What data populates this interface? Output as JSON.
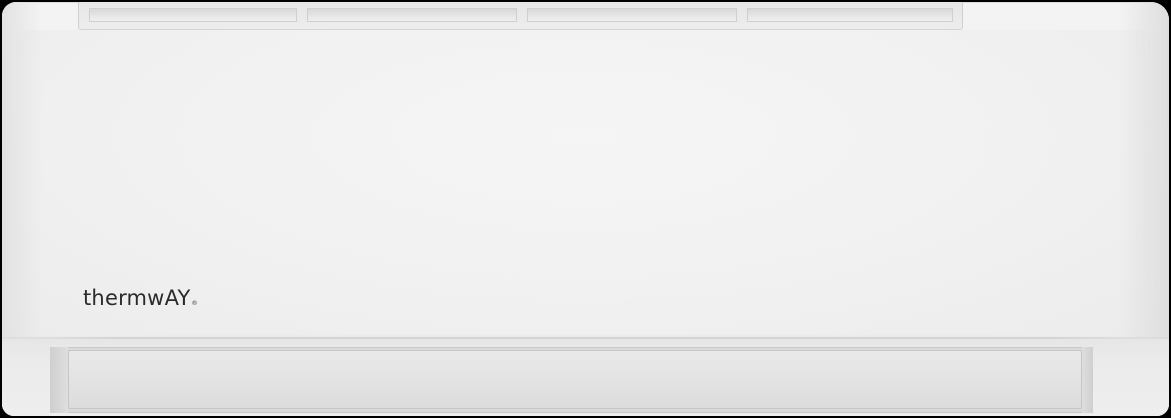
{
  "product": {
    "brand_main": "thermw",
    "brand_accent": "AY",
    "brand_mark": "®"
  },
  "colors": {
    "body": "#f1f1f1",
    "logo_text": "#2a2a2a",
    "background": "#000000"
  }
}
